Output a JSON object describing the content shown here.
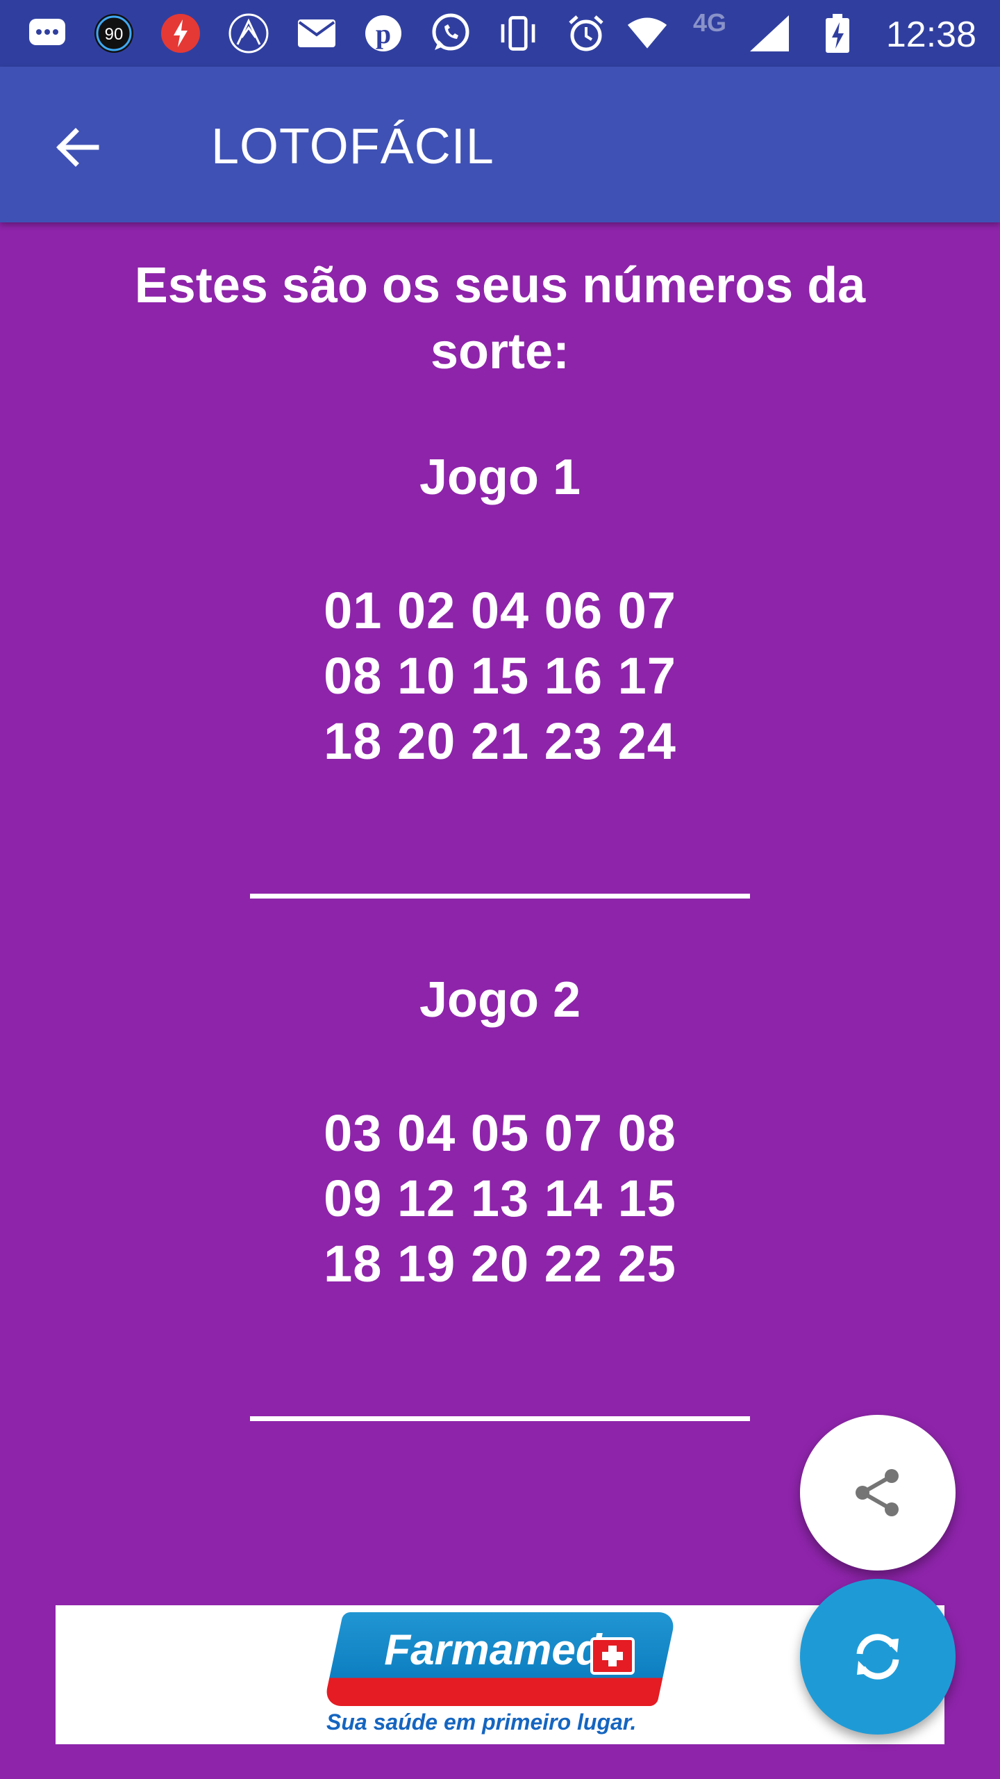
{
  "status_bar": {
    "time": "12:38",
    "network_label": "4G",
    "badge_number": "90",
    "icons": [
      "chat-icon",
      "badge-90-icon",
      "flash-app-icon",
      "arrow-app-icon",
      "mail-icon",
      "pinterest-icon",
      "whatsapp-icon",
      "vibrate-icon",
      "alarm-icon",
      "wifi-icon",
      "signal-icon",
      "battery-charging-icon"
    ]
  },
  "app_bar": {
    "title": "LOTOFÁCIL",
    "back_icon": "arrow-back-icon"
  },
  "content": {
    "intro_line1": "Estes são os seus números da",
    "intro_line2": "sorte:",
    "games": [
      {
        "title": "Jogo 1",
        "rows": [
          "01 02 04 06 07",
          "08 10 15 16 17",
          "18 20 21 23 24"
        ]
      },
      {
        "title": "Jogo 2",
        "rows": [
          "03 04 05 07 08",
          "09 12 13 14 15",
          "18 19 20 22 25"
        ]
      }
    ],
    "divider": "______________________"
  },
  "fabs": {
    "share_icon": "share-icon",
    "refresh_icon": "refresh-icon"
  },
  "ad": {
    "brand": "Farmamed",
    "tagline": "Sua saúde em primeiro lugar."
  },
  "colors": {
    "status_bar": "#303F9F",
    "app_bar": "#3F51B5",
    "background": "#8E24AA",
    "refresh_fab": "#1E9BD7",
    "share_fab": "#FFFFFF"
  }
}
